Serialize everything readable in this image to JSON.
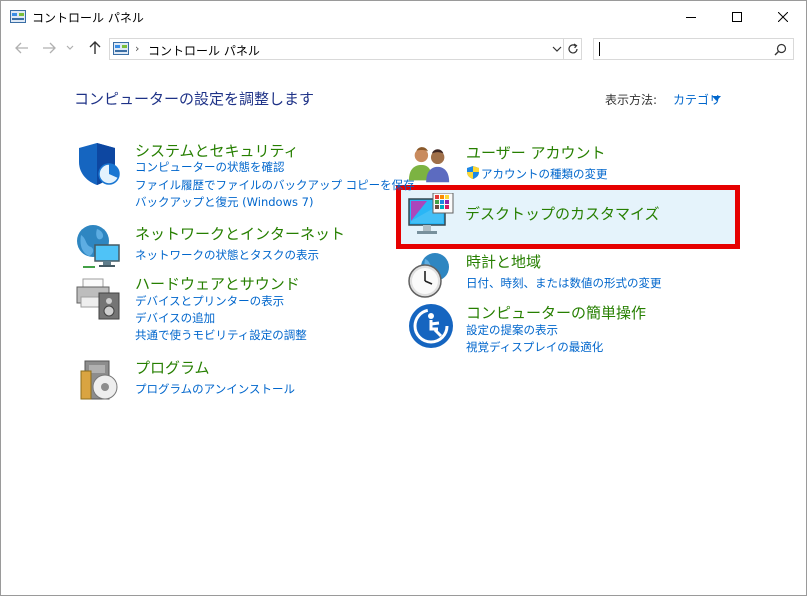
{
  "window": {
    "title": "コントロール パネル"
  },
  "address": {
    "crumb": "コントロール パネル"
  },
  "search": {
    "placeholder": ""
  },
  "heading": "コンピューターの設定を調整します",
  "view_by": {
    "label": "表示方法:",
    "value": "カテゴリ"
  },
  "categories": [
    {
      "title": "システムとセキュリティ",
      "icon": "security-shield-icon",
      "links": [
        "コンピューターの状態を確認",
        "ファイル履歴でファイルのバックアップ コピーを保存",
        "バックアップと復元 (Windows 7)"
      ]
    },
    {
      "title": "ネットワークとインターネット",
      "icon": "network-globe-icon",
      "links": [
        "ネットワークの状態とタスクの表示"
      ]
    },
    {
      "title": "ハードウェアとサウンド",
      "icon": "printer-speaker-icon",
      "links": [
        "デバイスとプリンターの表示",
        "デバイスの追加",
        "共通で使うモビリティ設定の調整"
      ]
    },
    {
      "title": "プログラム",
      "icon": "programs-disc-icon",
      "links": [
        "プログラムのアンインストール"
      ]
    },
    {
      "title": "ユーザー アカウント",
      "icon": "users-icon",
      "links": [
        "アカウントの種類の変更"
      ]
    },
    {
      "title": "デスクトップのカスタマイズ",
      "icon": "desktop-monitor-icon",
      "links": []
    },
    {
      "title": "時計と地域",
      "icon": "clock-globe-icon",
      "links": [
        "日付、時刻、または数値の形式の変更"
      ]
    },
    {
      "title": "コンピューターの簡単操作",
      "icon": "ease-of-access-icon",
      "links": [
        "設定の提案の表示",
        "視覚ディスプレイの最適化"
      ]
    }
  ],
  "colors": {
    "category_title": "#267f00",
    "link": "#0066cc",
    "heading": "#1e3287",
    "highlight_border": "#e60000",
    "highlight_fill": "#e5f3fb"
  }
}
